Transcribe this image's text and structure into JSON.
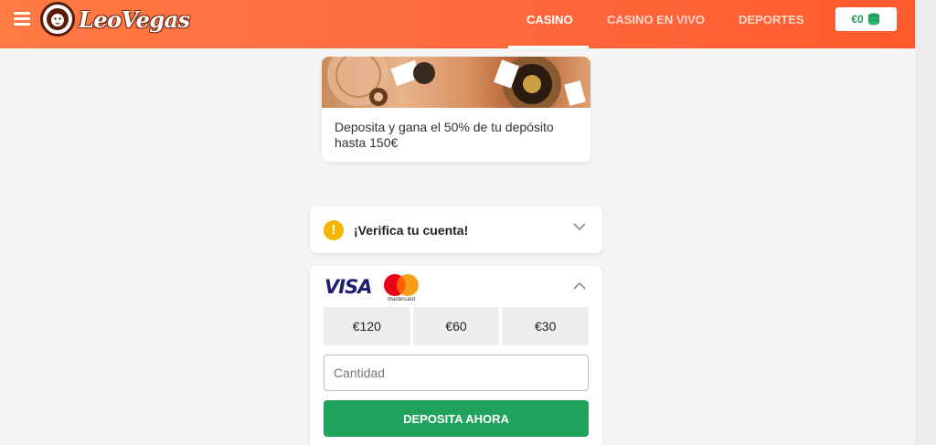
{
  "header": {
    "brand": "LeoVegas",
    "nav": [
      {
        "label": "CASINO",
        "active": true
      },
      {
        "label": "CASINO EN VIVO",
        "active": false
      },
      {
        "label": "DEPORTES",
        "active": false
      }
    ],
    "balance": "€0",
    "colors": {
      "accent": "#ff6a3d",
      "balance_text": "#1e9e5a"
    }
  },
  "promo": {
    "text": "Deposita y gana el 50% de tu depósito hasta 150€"
  },
  "verify": {
    "label": "¡Verifica tu cuenta!",
    "icon": "warning-icon"
  },
  "payment": {
    "visa_label": "VISA",
    "mastercard_label": "mastercard",
    "amounts": [
      "€120",
      "€60",
      "€30"
    ],
    "amount_placeholder": "Cantidad",
    "deposit_label": "DEPOSITA AHORA",
    "colors": {
      "button": "#1fa35c"
    }
  }
}
